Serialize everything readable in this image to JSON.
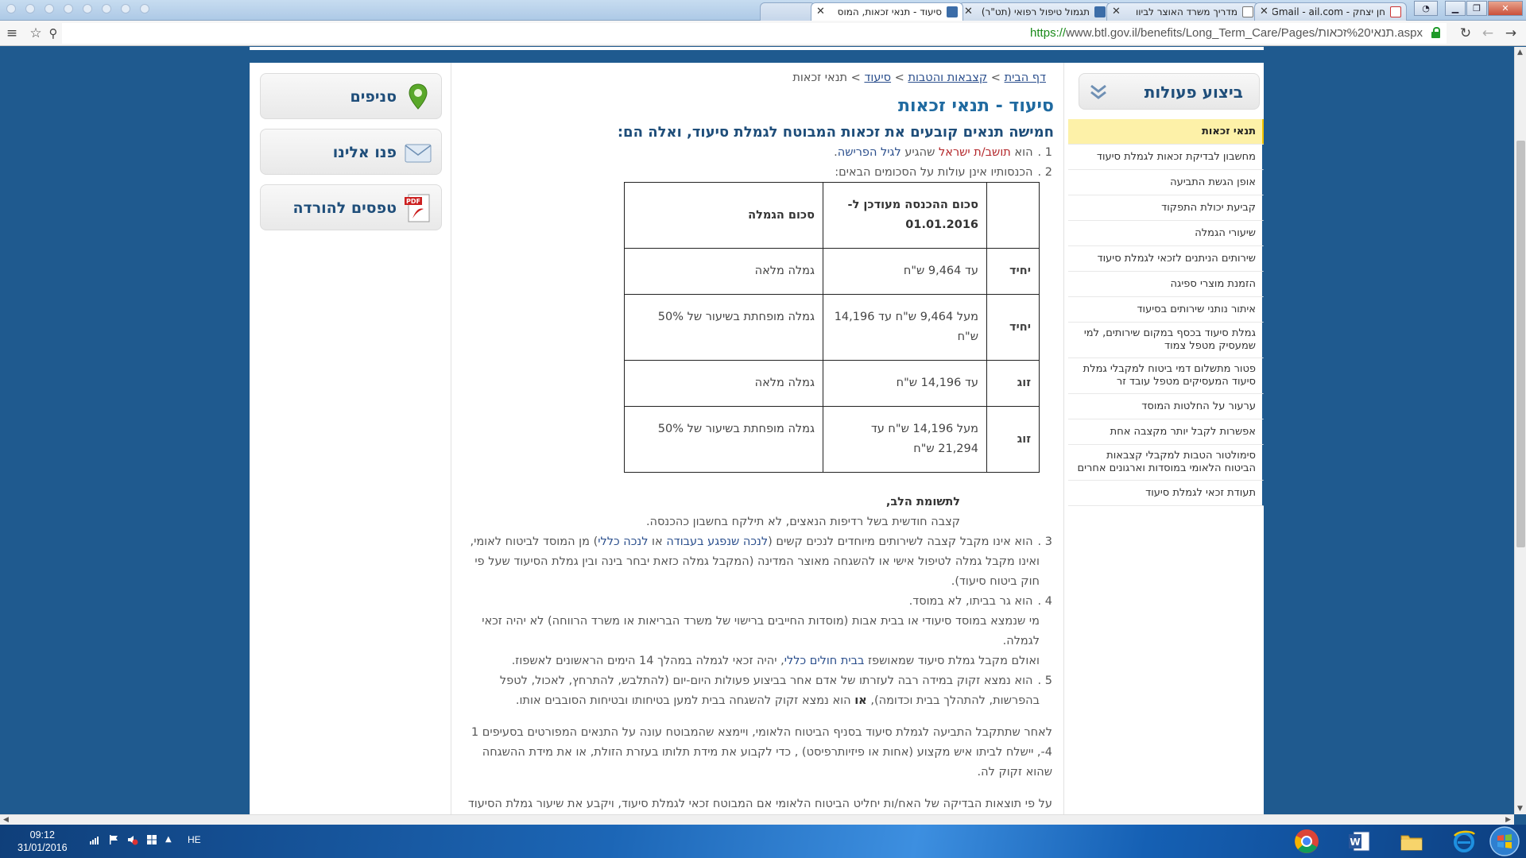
{
  "browser": {
    "tabs": [
      {
        "label": "",
        "favicon": "empty-tab",
        "active": false
      },
      {
        "label": "סיעוד - תנאי זכאות, המוס",
        "favicon": "btl-icon",
        "active": true
      },
      {
        "label": "תגמול טיפול רפואי (תט\"ר)",
        "favicon": "btl-icon",
        "active": false
      },
      {
        "label": "מדריך משרד האוצר לביוו",
        "favicon": "page-icon",
        "active": false
      },
      {
        "label": "חן יצחק - Gmail - ail.com",
        "favicon": "gmail-icon",
        "active": false
      }
    ],
    "url_scheme": "https://",
    "url_rest": "www.btl.gov.il/benefits/Long_Term_Care/Pages/תנאי%20זכאות.aspx"
  },
  "left_panel": {
    "buttons": [
      {
        "label": "סניפים",
        "icon": "map-pin-icon"
      },
      {
        "label": "פנו אלינו",
        "icon": "envelope-icon"
      },
      {
        "label": "טפסים להורדה",
        "icon": "pdf-icon"
      }
    ]
  },
  "breadcrumb": {
    "home": "דף הבית",
    "sep": " > ",
    "benefits": "קצבאות והטבות",
    "care": "סיעוד",
    "current": "תנאי זכאות"
  },
  "main": {
    "title": "סיעוד - תנאי זכאות",
    "subtitle": "חמישה תנאים קובעים את זכאות המבוטח לגמלת סיעוד, ואלה הם:",
    "item1": {
      "num": "1 .",
      "pre": "הוא ",
      "link": "תושב/ת ישראל",
      "mid": " שהגיע ",
      "link2": "לגיל הפרישה",
      "post": "."
    },
    "item2": {
      "num": "2 .",
      "text": "הכנסותיו אינן עולות על הסכומים הבאים:"
    },
    "table": {
      "headers": [
        "",
        "סכום ההכנסה מעודכן ל- 01.01.2016",
        "סכום הגמלה"
      ],
      "rows": [
        {
          "who": "יחיד",
          "income": "עד 9,464 ש\"ח",
          "benefit": "גמלה מלאה"
        },
        {
          "who": "יחיד",
          "income": "מעל 9,464 ש\"ח עד 14,196 ש\"ח",
          "benefit": "גמלה מופחתת בשיעור של 50%"
        },
        {
          "who": "זוג",
          "income": "עד 14,196 ש\"ח",
          "benefit": "גמלה מלאה"
        },
        {
          "who": "זוג",
          "income": "מעל 14,196 ש\"ח עד 21,294 ש\"ח",
          "benefit": "גמלה מופחתת בשיעור של 50%"
        }
      ]
    },
    "note_title": "לתשומת הלב,",
    "note_text": "קצבה חודשית בשל רדיפות הנאצים, לא תילקח בחשבון כהכנסה.",
    "item3": {
      "num": "3 .",
      "pre": "הוא אינו מקבל קצבה לשירותים מיוחדים לנכים קשים (",
      "link1": "לנכה שנפגע בעבודה",
      "or": " או ",
      "link2": "לנכה כללי",
      "post": ") מן המוסד לביטוח לאומי,",
      "line2": "ואינו מקבל גמלה לטיפול אישי או להשגחה מאוצר המדינה (המקבל גמלה כזאת יבחר בינה ובין גמלת הסיעוד שעל פי",
      "line3": "חוק ביטוח סיעוד)."
    },
    "item4": {
      "num": "4 .",
      "text": "הוא גר בביתו, לא במוסד."
    },
    "item4_note1": "מי שנמצא במוסד סיעודי או בבית אבות (מוסדות החייבים ברישוי של משרד הבריאות או משרד הרווחה) לא יהיה זכאי",
    "item4_note1b": "לגמלה.",
    "item4_note2": {
      "pre": "ואולם מקבל גמלת סיעוד שמאושפז ",
      "link": "בבית חולים כללי",
      "post": ", יהיה זכאי לגמלה במהלך 14 הימים הראשונים לאשפוז."
    },
    "item5": {
      "num": "5 .",
      "line1": "הוא נמצא זקוק במידה רבה לעזרתו של אדם אחר בביצוע פעולות היום-יום (להתלבש, להתרחץ, לאכול, לטפל",
      "line2_pre": "בהפרשות, להתהלך בבית וכדומה), ",
      "line2_bold": "או",
      "line2_post": " הוא נמצא זקוק להשגחה בבית למען בטיחותו ובטיחות הסובבים אותו."
    },
    "after1": "לאחר שתתקבל התביעה לגמלת סיעוד בסניף הביטוח הלאומי, ויימצא שהמבוטח עונה על התנאים המפורטים בסעיפים 1",
    "after2": "4-, יישלח לביתו איש מקצוע (אחות או פיזיותרפיסט) , כדי לקבוע את מידת תלותו בעזרת הזולת, או את מידת ההשגחה",
    "after3": "שהוא זקוק לה.",
    "after4": "על פי תוצאות הבדיקה של האח/ות יחליט הביטוח הלאומי אם המבוטח זכאי לגמלת סיעוד, ויקבע את שיעור גמלת הסיעוד"
  },
  "side_panel": {
    "title": "ביצוע פעולות",
    "items": [
      "תנאי זכאות",
      "מחשבון לבדיקת זכאות לגמלת סיעוד",
      "אופן הגשת התביעה",
      "קביעת יכולת התפקוד",
      "שיעורי הגמלה",
      "שירותים הניתנים לזכאי לגמלת סיעוד",
      "הזמנת מוצרי ספיגה",
      "איתור נותני שירותים בסיעוד",
      "גמלת סיעוד בכסף במקום שירותים, למי שמעסיק מטפל צמוד",
      "פטור מתשלום דמי ביטוח למקבלי גמלת סיעוד המעסיקים מטפל עובד זר",
      "ערעור על החלטות המוסד",
      "אפשרות לקבל יותר מקצבה אחת",
      "סימולטור הטבות למקבלי קצבאות הביטוח הלאומי במוסדות וארגונים אחרים",
      "תעודת זכאי לגמלת סיעוד"
    ],
    "active_index": 0
  },
  "taskbar": {
    "time": "09:12",
    "date": "31/01/2016",
    "lang": "HE",
    "apps": [
      "chrome-icon",
      "word-icon",
      "explorer-icon",
      "ie-icon"
    ]
  },
  "colors": {
    "brand_blue": "#1f5a8f",
    "title_blue": "#1f6aa0",
    "active_yellow": "#fdf1a8",
    "link_red": "#b3262a"
  }
}
